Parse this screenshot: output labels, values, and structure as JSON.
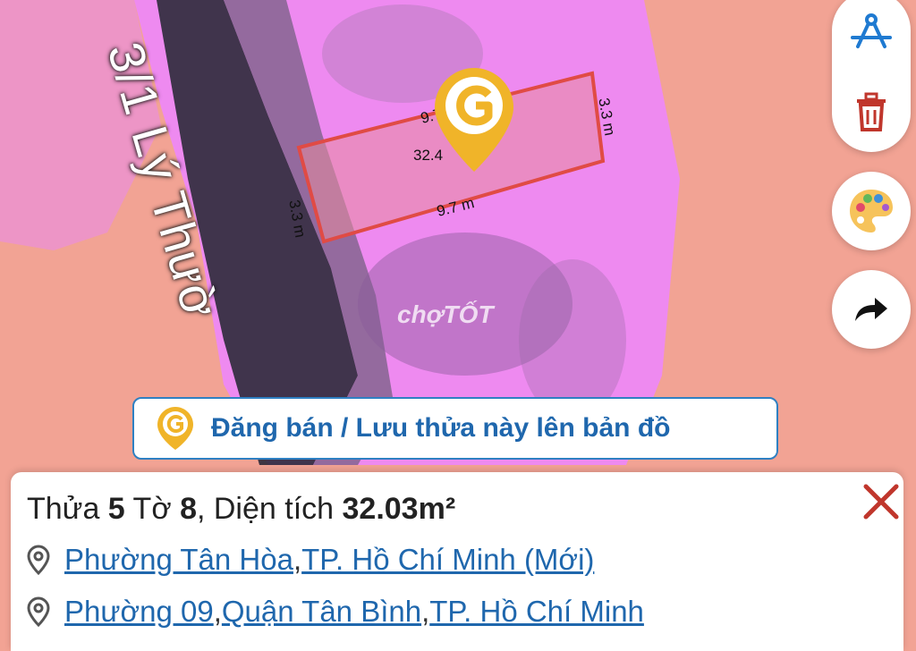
{
  "map": {
    "street_name": "3/1 Lý Thườ",
    "parcel": {
      "side_top": "9.7 m",
      "side_bottom": "9.7 m",
      "side_left": "3.3 m",
      "side_right": "3.3 m",
      "area_partial": "32.4"
    },
    "watermark": "chợTỐT",
    "colors": {
      "land_residential": "#f2a394",
      "land_mixed": "#ee8af0",
      "parcel_border": "#e04b45",
      "pin": "#f0b429"
    }
  },
  "controls": {
    "measure_icon": "compass-measure-icon",
    "delete_icon": "trash-icon",
    "palette_icon": "palette-icon",
    "share_icon": "share-arrow-icon"
  },
  "cta": {
    "label": "Đăng bán / Lưu thửa này lên bản đồ",
    "icon": "g-pin-icon"
  },
  "info_panel": {
    "title_prefix": "Thửa ",
    "plot_number": "5",
    "sheet_label": " Tờ ",
    "sheet_number": "8",
    "area_label": ", Diện tích ",
    "area_value": "32.03m²",
    "address_new": {
      "ward": "Phường Tân Hòa",
      "sep": ", ",
      "city": "TP. Hồ Chí Minh (Mới)"
    },
    "address_old": {
      "ward": "Phường 09",
      "sep1": ", ",
      "district": "Quận Tân Bình",
      "sep2": ", ",
      "city": "TP. Hồ Chí Minh"
    }
  }
}
